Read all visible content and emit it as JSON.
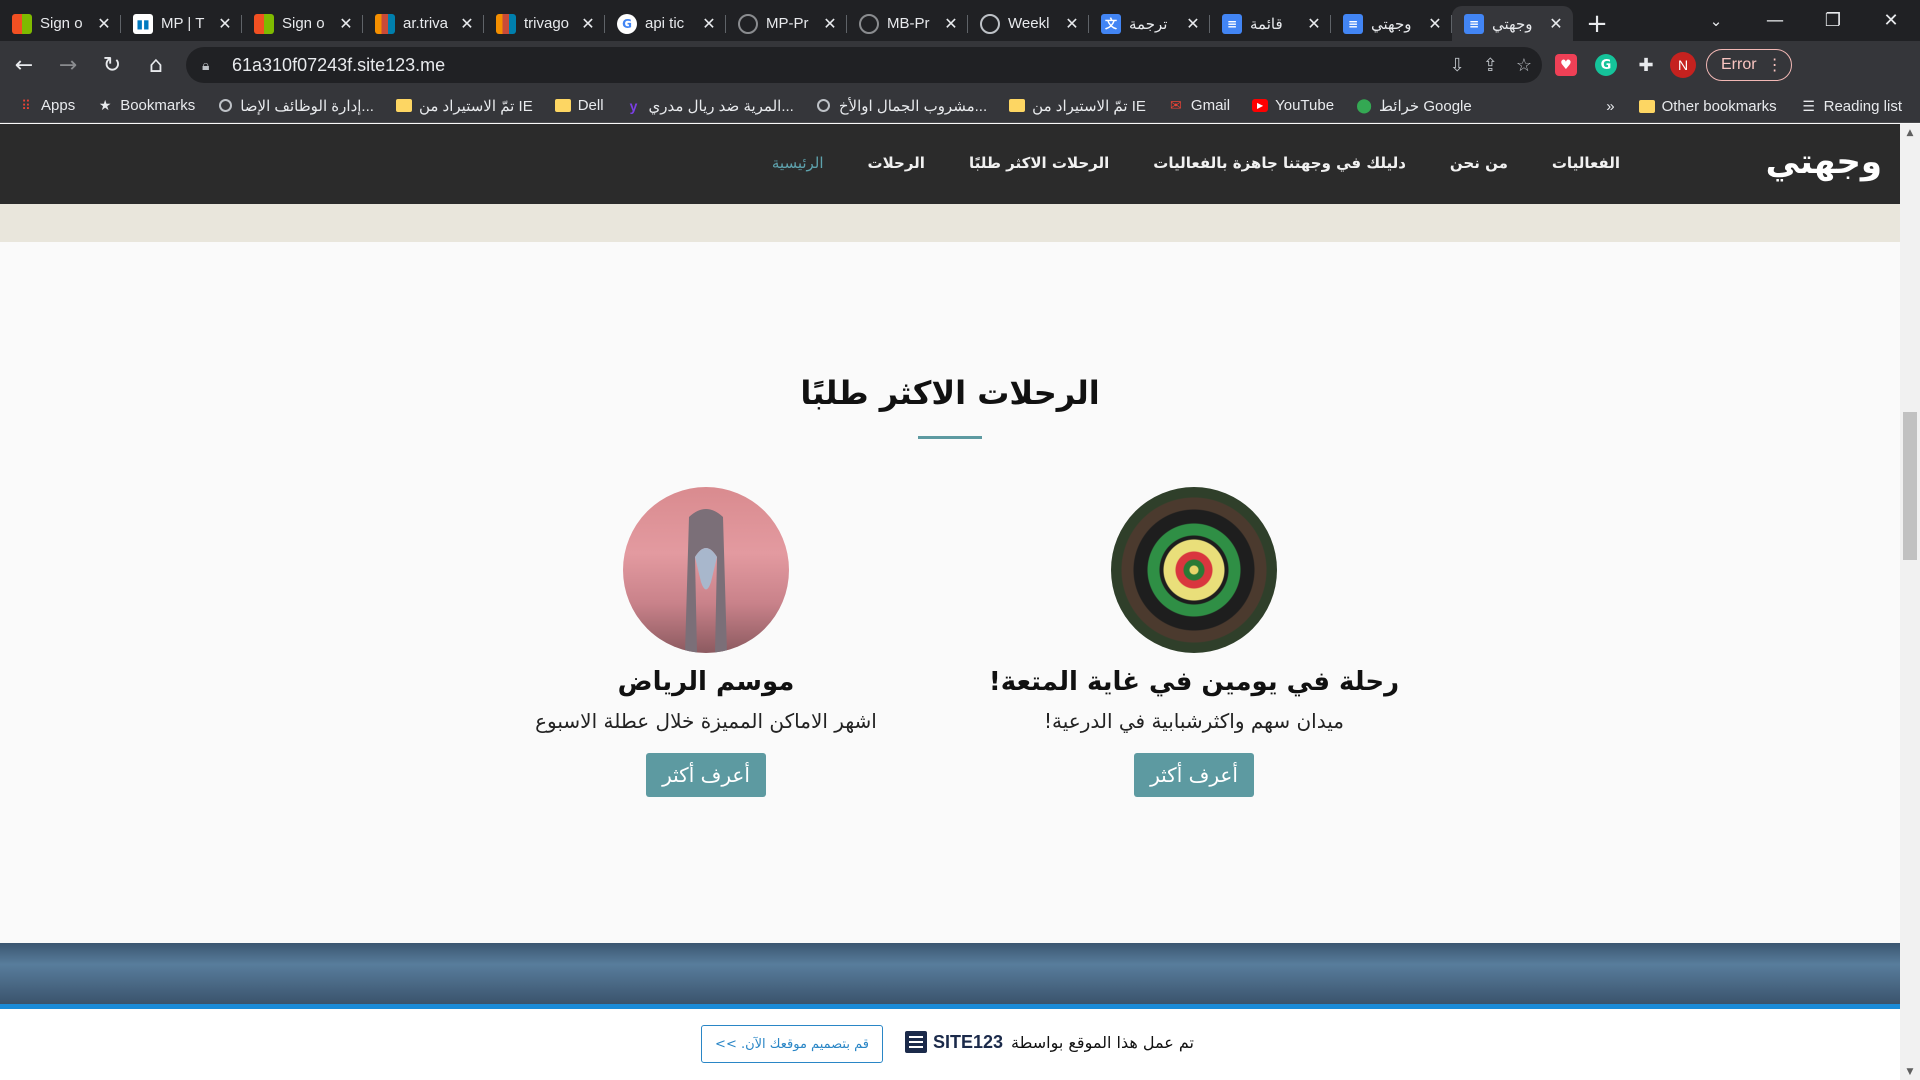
{
  "browser": {
    "tabs": [
      {
        "title": "Sign o",
        "icon": "microsoft-icon"
      },
      {
        "title": "MP | T",
        "icon": "trello-icon"
      },
      {
        "title": "Sign o",
        "icon": "microsoft-icon"
      },
      {
        "title": "ar.triva",
        "icon": "trivago-icon"
      },
      {
        "title": "trivago",
        "icon": "trivago-icon"
      },
      {
        "title": "api tic",
        "icon": "google-icon"
      },
      {
        "title": "MP-Pr",
        "icon": "github-icon"
      },
      {
        "title": "MB-Pr",
        "icon": "github-icon"
      },
      {
        "title": "Weekl",
        "icon": "globe-icon"
      },
      {
        "title": "ترجمة",
        "icon": "translate-icon"
      },
      {
        "title": "قائمة",
        "icon": "docs-icon"
      },
      {
        "title": "وجهتي",
        "icon": "docs-icon"
      },
      {
        "title": "وجهتي",
        "icon": "docs-icon"
      }
    ],
    "active_tab_index": 12,
    "url": "61a310f07243f.site123.me",
    "error_button": "Error",
    "profile_initial": "N",
    "bookmarks": [
      {
        "label": "Apps",
        "icon": "apps-grid-icon"
      },
      {
        "label": "Bookmarks",
        "icon": "star-icon"
      },
      {
        "label": "إدارة الوظائف الإضا...",
        "icon": "globe-icon"
      },
      {
        "label": "تمّ الاستيراد من IE",
        "icon": "folder-icon"
      },
      {
        "label": "Dell",
        "icon": "folder-icon"
      },
      {
        "label": "المرية ضد ريال مدري...",
        "icon": "yahoo-icon"
      },
      {
        "label": "مشروب الجمال اوالأخ...",
        "icon": "globe-icon"
      },
      {
        "label": "تمّ الاستيراد من IE",
        "icon": "folder-icon"
      },
      {
        "label": "Gmail",
        "icon": "gmail-icon"
      },
      {
        "label": "YouTube",
        "icon": "youtube-icon"
      },
      {
        "label": "خرائط Google",
        "icon": "maps-icon"
      }
    ],
    "bookmarks_overflow": "»",
    "other_bookmarks": "Other bookmarks",
    "reading_list": "Reading list"
  },
  "site": {
    "logo": "وجهتي",
    "menu": [
      "الرئيسية",
      "الرحلات",
      "الرحلات الاكثر طلبًا",
      "دليلك في وجهتنا جاهزة بالفعاليات",
      "من نحن",
      "الفعاليات"
    ],
    "active_menu_index": 0,
    "section_title": "الرحلات الاكثر طلبًا",
    "cards": [
      {
        "title": "رحلة في يومين في غاية المتعة!",
        "description": "ميدان سهم واكثرشبابية في الدرعية!",
        "button": "أعرف أكثر",
        "image": "dartboard-image"
      },
      {
        "title": "موسم الرياض",
        "description": "اشهر الاماكن المميزة خلال عطلة الاسبوع",
        "button": "أعرف أكثر",
        "image": "kingdom-tower-image"
      }
    ],
    "footer": {
      "made_with": "تم عمل هذا الموقع بواسطة",
      "brand": "SITE123",
      "cta": "قم بتصميم موقعك الآن. >>"
    }
  },
  "colors": {
    "accent": "#5d9aa1",
    "nav_bg": "#2b2b2b",
    "footer_line": "#1a8bd8"
  }
}
